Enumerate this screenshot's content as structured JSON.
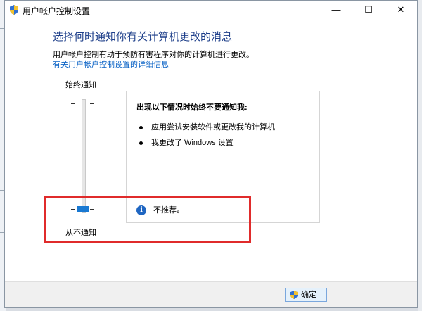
{
  "window": {
    "title": "用户帐户控制设置",
    "minimize_glyph": "—",
    "maximize_glyph": "☐",
    "close_glyph": "✕"
  },
  "main": {
    "heading": "选择何时通知你有关计算机更改的消息",
    "description": "用户帐户控制有助于预防有害程序对你的计算机进行更改。",
    "link": "有关用户帐户控制设置的详细信息"
  },
  "slider": {
    "top_label": "始终通知",
    "bottom_label": "从不通知",
    "levels": 4,
    "selected_level": 1
  },
  "info_panel": {
    "heading": "出现以下情况时始终不要通知我:",
    "bullets": [
      "应用尝试安装软件或更改我的计算机",
      "我更改了 Windows 设置"
    ],
    "note": "不推荐。",
    "info_icon_glyph": "i"
  },
  "footer": {
    "ok_label": "确定"
  },
  "icons": [
    "uac-shield-icon",
    "info-icon",
    "minimize-icon",
    "maximize-icon",
    "close-icon"
  ],
  "colors": {
    "heading": "#1e3f8a",
    "link": "#0b63c6",
    "slider_thumb": "#1979d2",
    "highlight_box": "#e02b2b"
  }
}
